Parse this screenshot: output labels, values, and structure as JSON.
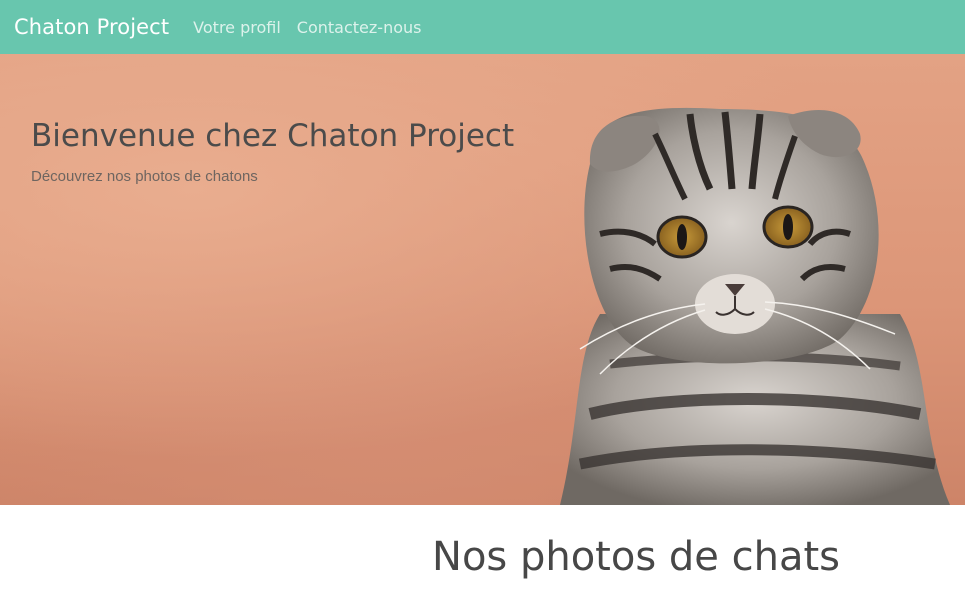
{
  "navbar": {
    "brand": "Chaton Project",
    "links": [
      "Votre profil",
      "Contactez-nous"
    ]
  },
  "hero": {
    "title": "Bienvenue chez Chaton Project",
    "subtitle": "Découvrez nos photos de chatons"
  },
  "section": {
    "title": "Nos photos de chats"
  },
  "colors": {
    "navbar": "#68c6ae",
    "hero_background": "#e3a284",
    "text_dark": "#4b4b4b"
  }
}
